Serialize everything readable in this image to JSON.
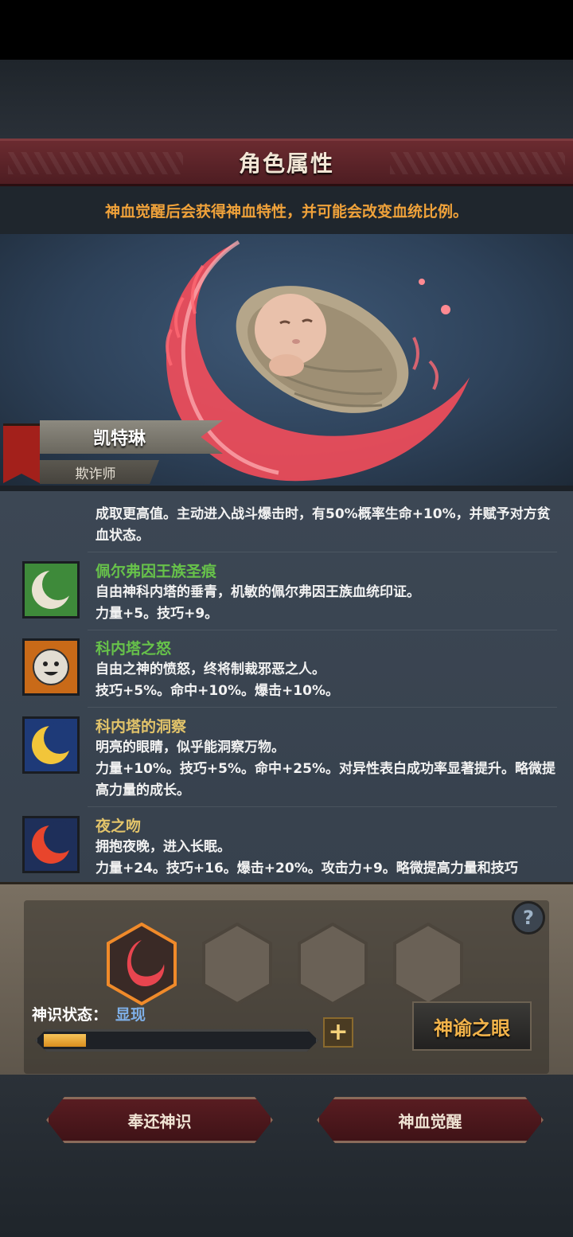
{
  "header": {
    "title": "角色属性"
  },
  "hint": "神血觉醒后会获得神血特性，并可能会改变血统比例。",
  "character": {
    "name": "凯特琳",
    "class": "欺诈师"
  },
  "traits": {
    "continued_text": "成取更高值。主动进入战斗爆击时，有50%概率生命+10%，并赋予对方贫血状态。",
    "items": [
      {
        "name": "佩尔弗因王族圣痕",
        "desc": "自由神科内塔的垂青，机敏的佩尔弗因王族血统印证。",
        "stats": "力量+5。技巧+9。",
        "icon": "moon-crescent-icon",
        "color": "green"
      },
      {
        "name": "科内塔之怒",
        "desc": "自由之神的愤怒，终将制裁邪恶之人。",
        "stats": "技巧+5%。命中+10%。爆击+10%。",
        "icon": "smiling-sun-icon",
        "color": "green"
      },
      {
        "name": "科内塔的洞察",
        "desc": "明亮的眼睛，似乎能洞察万物。",
        "stats": "力量+10%。技巧+5%。命中+25%。对异性表白成功率显著提升。略微提高力量的成长。",
        "icon": "golden-moon-icon",
        "color": "gold"
      },
      {
        "name": "夜之吻",
        "desc": "拥抱夜晚，进入长眠。",
        "stats": "力量+24。技巧+16。爆击+20%。攻击力+9。略微提高力量和技巧",
        "icon": "red-moon-icon",
        "color": "gold"
      }
    ]
  },
  "divine_sense": {
    "state_label": "神识状态：",
    "state_value": "显现",
    "progress": 0.16,
    "oracle_button": "神谕之眼",
    "help": "?",
    "plus": "+"
  },
  "actions": {
    "return_button": "奉还神识",
    "awaken_button": "神血觉醒"
  },
  "colors": {
    "accent_red": "#e8454f",
    "gold": "#e3c46a",
    "green": "#67c24a",
    "orange": "#f0a23a"
  }
}
